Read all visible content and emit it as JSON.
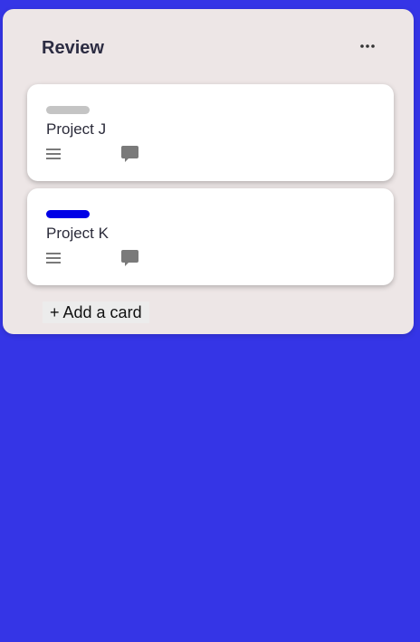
{
  "column": {
    "title": "Review",
    "more_icon": "ellipsis-icon",
    "add_card_label": "+ Add a card"
  },
  "cards": [
    {
      "title": "Project J",
      "label_color": "#c4c4c4",
      "icons": [
        "description-icon",
        "comment-icon"
      ]
    },
    {
      "title": "Project K",
      "label_color": "#0000e6",
      "icons": [
        "description-icon",
        "comment-icon"
      ]
    }
  ],
  "colors": {
    "background": "#3535e6",
    "column_background": "#ede6e6",
    "card_background": "#ffffff",
    "icon_gray": "#7a7a7a"
  }
}
